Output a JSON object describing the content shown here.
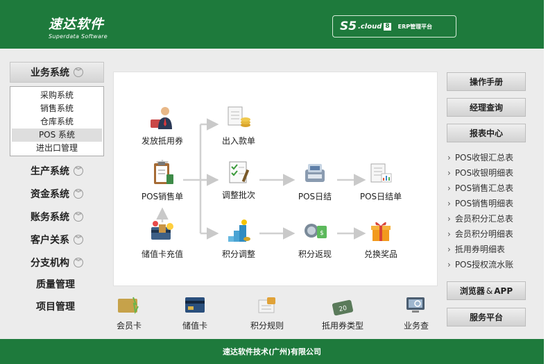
{
  "header": {
    "brand_cn": "速达软件",
    "brand_en": "Superdata Software",
    "product_s5": "S5",
    "product_cloud": ".cloud",
    "product_badge": "8",
    "product_erp": "ERP管理平台"
  },
  "sidebar": {
    "business_systems": "业务系统",
    "submenu": [
      "采购系统",
      "销售系统",
      "仓库系统",
      "POS 系统",
      "进出口管理"
    ],
    "active_submenu": "POS 系统",
    "items": [
      {
        "label": "生产系统",
        "expandable": true
      },
      {
        "label": "资金系统",
        "expandable": true
      },
      {
        "label": "账务系统",
        "expandable": true
      },
      {
        "label": "客户关系",
        "expandable": true
      },
      {
        "label": "分支机构",
        "expandable": true
      },
      {
        "label": "质量管理",
        "expandable": false
      },
      {
        "label": "项目管理",
        "expandable": false
      }
    ]
  },
  "flow": {
    "nodes": [
      {
        "label": "发放抵用券",
        "icon": "cashier-person-icon"
      },
      {
        "label": "出入款单",
        "icon": "money-document-icon"
      },
      {
        "label": "POS销售单",
        "icon": "sales-clipboard-icon"
      },
      {
        "label": "调整批次",
        "icon": "checklist-icon"
      },
      {
        "label": "POS日结",
        "icon": "pos-terminal-icon"
      },
      {
        "label": "POS日结单",
        "icon": "daily-report-icon"
      },
      {
        "label": "储值卡充值",
        "icon": "card-recharge-icon"
      },
      {
        "label": "积分调整",
        "icon": "points-stairs-icon"
      },
      {
        "label": "积分返现",
        "icon": "points-cashback-icon"
      },
      {
        "label": "兑换奖品",
        "icon": "gift-box-icon"
      }
    ]
  },
  "quick_links": [
    {
      "label": "会员卡",
      "icon": "member-card-icon"
    },
    {
      "label": "储值卡",
      "icon": "stored-card-icon"
    },
    {
      "label": "积分规则",
      "icon": "points-rule-icon"
    },
    {
      "label": "抵用券类型",
      "icon": "coupon-icon"
    },
    {
      "label": "业务查",
      "icon": "business-query-icon"
    }
  ],
  "right": {
    "manual": "操作手册",
    "manager_query": "经理查询",
    "report_center": "报表中心",
    "reports": [
      "POS收银汇总表",
      "POS收银明细表",
      "POS销售汇总表",
      "POS销售明细表",
      "会员积分汇总表",
      "会员积分明细表",
      "抵用券明细表",
      "POS授权流水账"
    ],
    "browser": "浏览器",
    "amp": "&",
    "app": "APP",
    "service": "服务平台"
  },
  "footer": {
    "company": "速达软件技术(广州)有限公司"
  },
  "colors": {
    "brand_green": "#1e7a3c",
    "panel_bg": "#ececec"
  }
}
